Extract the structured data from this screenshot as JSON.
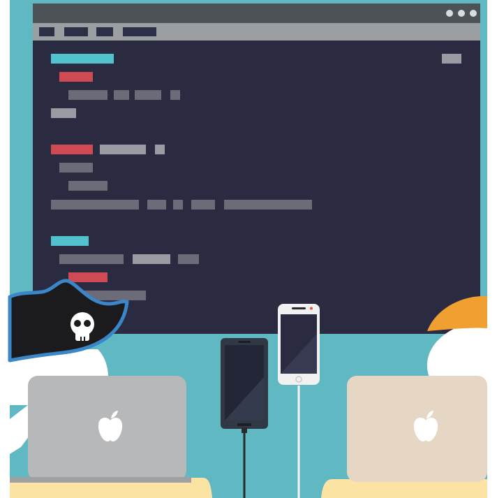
{
  "colors": {
    "backdrop": "#5fb8c2",
    "window_titlebar": "#4c5256",
    "window_menubar": "#9c9fa1",
    "menu_block": "#2c2f45",
    "editor_background": "#2a2a40",
    "code_cyan": "#52c2cf",
    "code_red": "#cf4a52",
    "code_gray": "#6b6c77",
    "code_light_gray": "#9a9ba2",
    "window_control_dot": "#d9dbdc",
    "pirate_hat": "#1b1b1d",
    "hat_trim": "#3b86c8",
    "skull": "#ffffff",
    "character_body": "#ffffff",
    "character_hair": "#f0a030",
    "laptop_silver": "#b7b8ba",
    "laptop_gold": "#e6d7c4",
    "apple_logo": "#ffffff",
    "desk": "#fbe3a4",
    "android_phone_body": "#2f3844",
    "iphone_body": "#f1f1f1",
    "phone_screen": "#2a2a40",
    "cable": "#2a2a2a",
    "cable_white": "#f5f5f5"
  },
  "icons": {
    "window_controls": "three-dots-icon",
    "hat_emblem": "skull-icon",
    "laptop_logo": "apple-logo-icon"
  }
}
